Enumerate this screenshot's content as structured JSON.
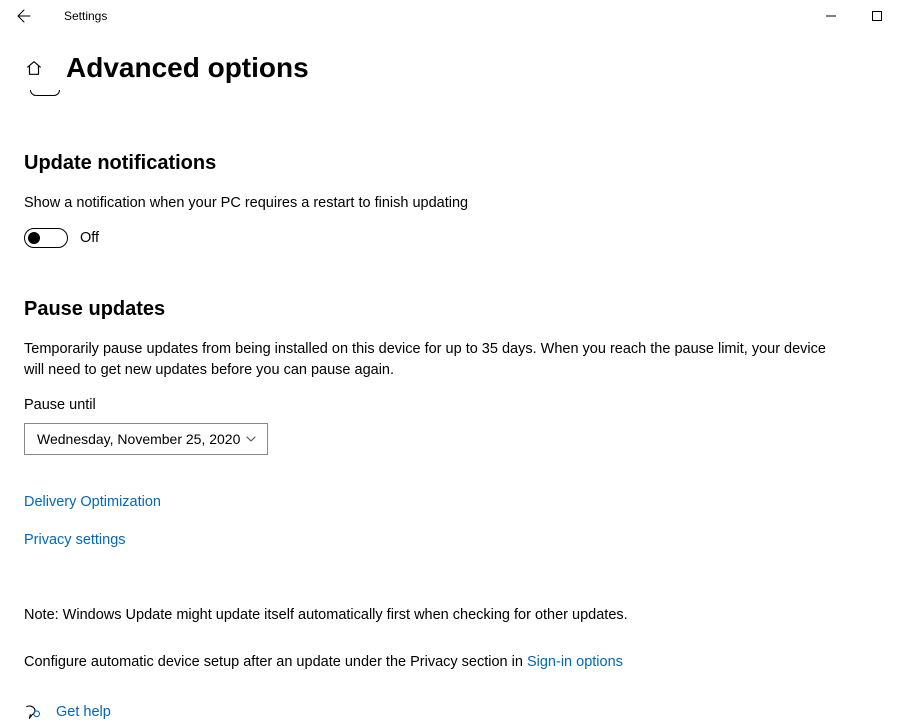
{
  "titlebar": {
    "title": "Settings"
  },
  "header": {
    "page_title": "Advanced options"
  },
  "update_notifications": {
    "heading": "Update notifications",
    "description": "Show a notification when your PC requires a restart to finish updating",
    "toggle_state": "Off"
  },
  "pause_updates": {
    "heading": "Pause updates",
    "description": "Temporarily pause updates from being installed on this device for up to 35 days. When you reach the pause limit, your device will need to get new updates before you can pause again.",
    "field_label": "Pause until",
    "selected": "Wednesday, November 25, 2020"
  },
  "links": {
    "delivery_optimization": "Delivery Optimization",
    "privacy_settings": "Privacy settings"
  },
  "notes": {
    "line1": "Note: Windows Update might update itself automatically first when checking for other updates.",
    "line2_prefix": "Configure automatic device setup after an update under the Privacy section in ",
    "line2_link": "Sign-in options"
  },
  "help": {
    "label": "Get help"
  }
}
